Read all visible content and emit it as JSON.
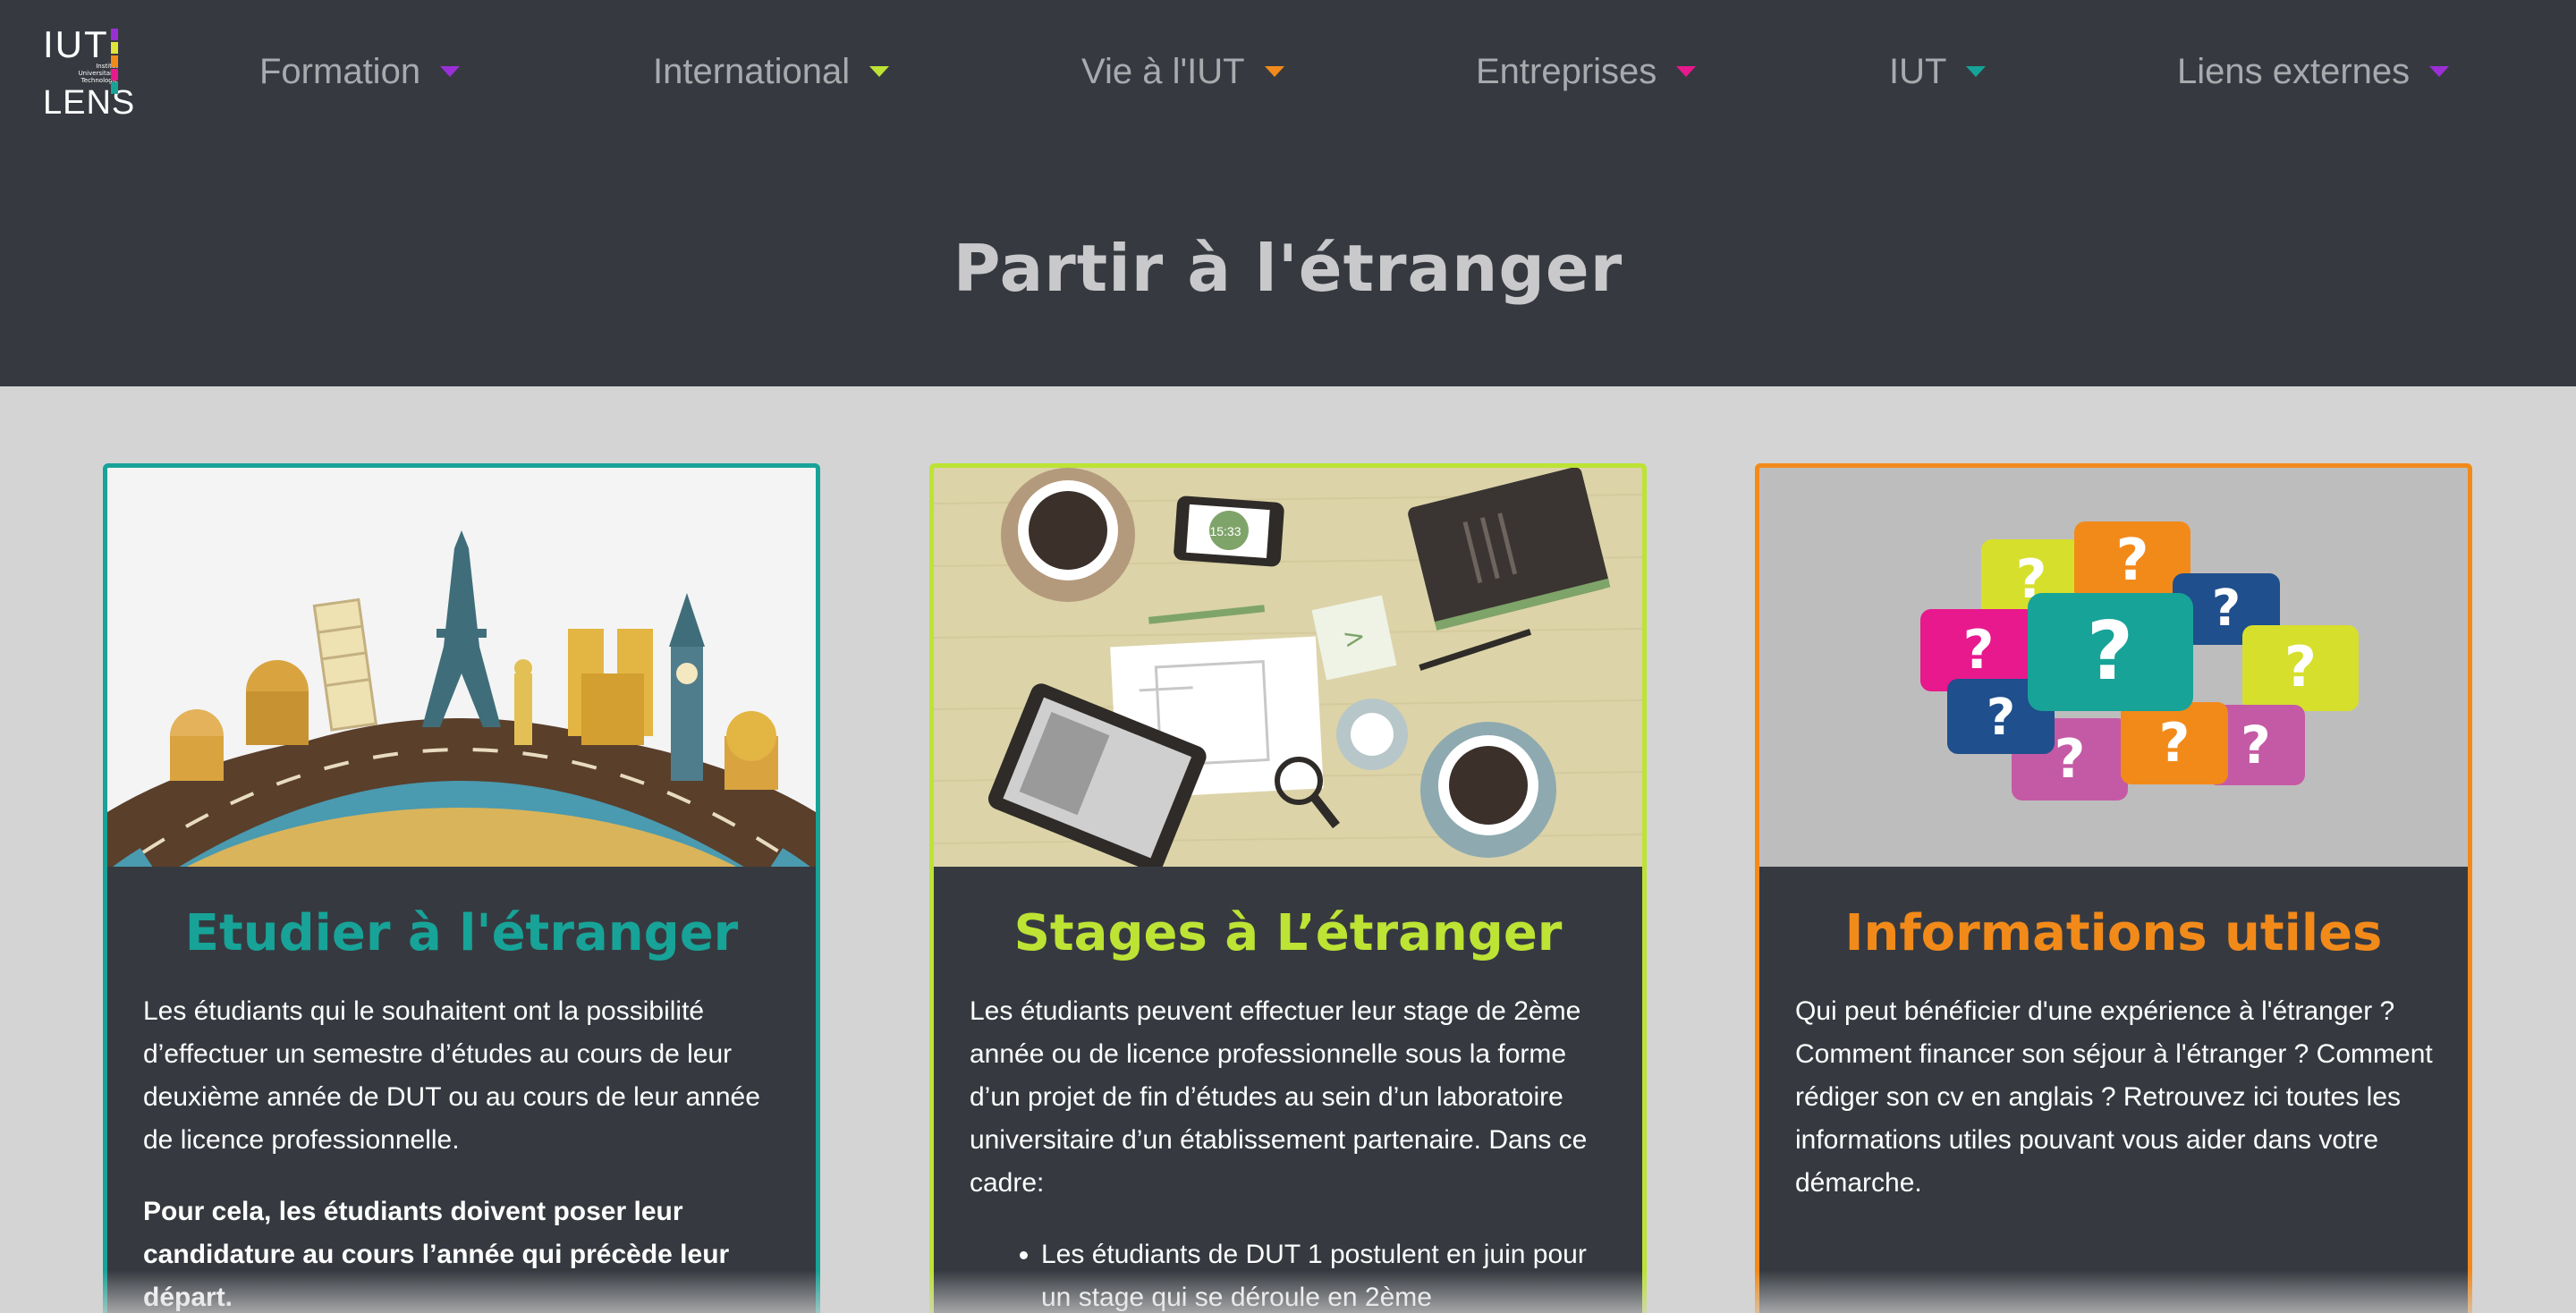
{
  "logo": {
    "top": "IUT",
    "subtitle": "Institut Universitaire Technologie",
    "bottom": "LENS",
    "colors": [
      "#9b2fd6",
      "#e0e33a",
      "#f28a1a",
      "#e8188d",
      "#17a398"
    ]
  },
  "nav": [
    {
      "label": "Formation",
      "caret_color": "#9b2fd6"
    },
    {
      "label": "International",
      "caret_color": "#bde334"
    },
    {
      "label": "Vie à l'IUT",
      "caret_color": "#f28a1a"
    },
    {
      "label": "Entreprises",
      "caret_color": "#e8188d"
    },
    {
      "label": "IUT",
      "caret_color": "#17a398"
    },
    {
      "label": "Liens externes",
      "caret_color": "#9b2fd6"
    }
  ],
  "page_title": "Partir à l'étranger",
  "cards": [
    {
      "title": "Etudier à l'étranger",
      "accent": "#17a398",
      "paragraph": "Les étudiants qui le souhaitent ont la possibilité d’effectuer un semestre d’études au cours de leur deuxième année de DUT ou au cours de leur année de licence professionnelle.",
      "bold_paragraph": "Pour cela, les étudiants doivent poser leur candidature au cours l’année qui précède leur départ."
    },
    {
      "title": "Stages à L’étranger",
      "accent": "#bde334",
      "paragraph": "Les étudiants peuvent effectuer leur stage de 2ème année ou de licence professionnelle sous la forme d’un projet de fin d’études au sein d’un laboratoire universitaire d’un établissement partenaire. Dans ce cadre:",
      "bullet": "Les étudiants de DUT 1 postulent en juin pour un stage qui se déroule en 2ème",
      "phone_time": "15:33"
    },
    {
      "title": "Informations utiles",
      "accent": "#f28a1a",
      "paragraph": "Qui peut bénéficier d'une expérience à l'étranger ? Comment financer son séjour à l'étranger ? Comment rédiger son cv en anglais ? Retrouvez ici toutes les informations utiles pouvant vous aider dans votre démarche.",
      "bubble_symbol": "?"
    }
  ]
}
